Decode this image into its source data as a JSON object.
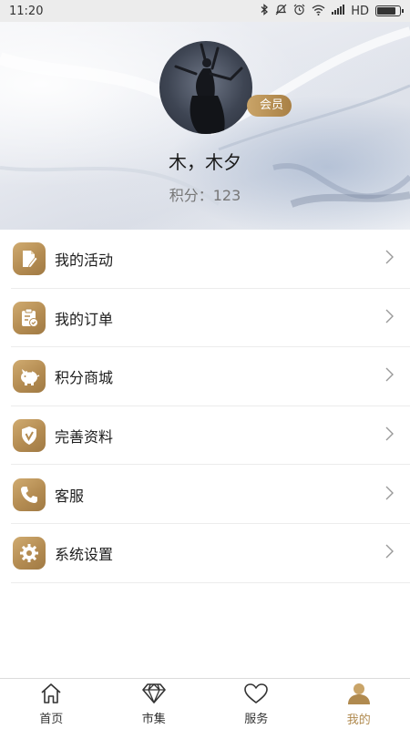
{
  "status_bar": {
    "time": "11:20",
    "network": "HD",
    "icons": [
      "bluetooth-icon",
      "mute-icon",
      "alarm-icon",
      "wifi-icon",
      "signal-icon",
      "battery-icon"
    ]
  },
  "profile": {
    "member_badge": "会员",
    "name": "木，木夕",
    "points_text": "积分：123"
  },
  "menu": {
    "items": [
      {
        "label": "我的活动",
        "icon": "activity-icon"
      },
      {
        "label": "我的订单",
        "icon": "order-icon"
      },
      {
        "label": "积分商城",
        "icon": "piggy-bank-icon"
      },
      {
        "label": "完善资料",
        "icon": "shield-check-icon"
      },
      {
        "label": "客服",
        "icon": "phone-icon"
      },
      {
        "label": "系统设置",
        "icon": "gear-icon"
      }
    ]
  },
  "bottom_nav": {
    "items": [
      {
        "label": "首页",
        "icon": "home-icon"
      },
      {
        "label": "市集",
        "icon": "diamond-icon"
      },
      {
        "label": "服务",
        "icon": "heart-icon"
      },
      {
        "label": "我的",
        "icon": "user-icon"
      }
    ],
    "active_index": 3
  },
  "colors": {
    "accent_gold": "#b08a4f",
    "icon_gold": "#c09a5e",
    "badge_gold": "#b98f52"
  }
}
